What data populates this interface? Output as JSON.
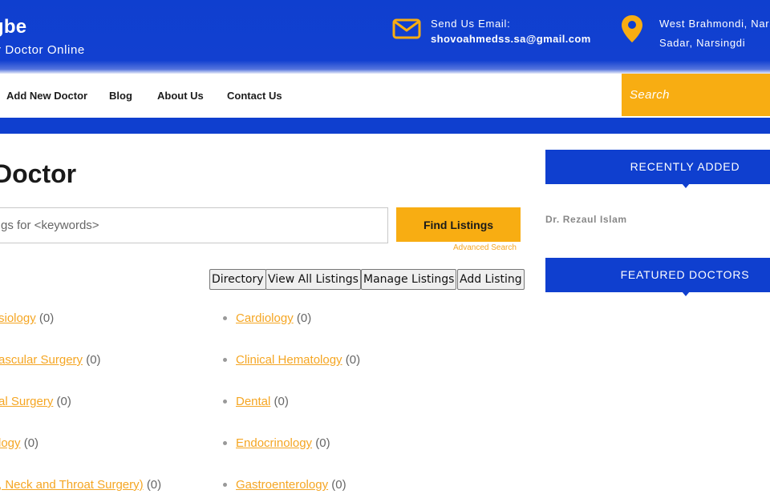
{
  "header": {
    "brand_title": "gbe",
    "brand_subtitle": "r Doctor Online",
    "email_label": "Send Us Email:",
    "email_value": "shovoahmedss.sa@gmail.com",
    "address_line1": "West Brahmondi, Nars",
    "address_line2": "Sadar, Narsingdi",
    "icons": {
      "email": "envelope-icon",
      "address": "map-pin-icon"
    },
    "colors": {
      "primary": "#0f3fcf",
      "accent": "#f8ad12"
    }
  },
  "nav": {
    "items": [
      "Add New Doctor",
      "Blog",
      "About Us",
      "Contact Us"
    ],
    "search_placeholder": "Search"
  },
  "main": {
    "title": "Doctor",
    "search_placeholder": "gs for <keywords>",
    "find_button": "Find Listings",
    "advanced_search": "Advanced Search",
    "action_buttons": [
      "Directory",
      "View All Listings",
      "Manage Listings",
      "Add Listing"
    ],
    "categories_left": [
      {
        "name": "siology",
        "count": "(0)"
      },
      {
        "name": "ascular Surgery",
        "count": "(0)"
      },
      {
        "name": "al Surgery",
        "count": "(0)"
      },
      {
        "name": "logy",
        "count": "(0)"
      },
      {
        "name": ", Neck and Throat Surgery)",
        "count": "(0)"
      }
    ],
    "categories_right": [
      {
        "name": "Cardiology",
        "count": "(0)"
      },
      {
        "name": "Clinical Hematology",
        "count": "(0)"
      },
      {
        "name": "Dental",
        "count": "(0)"
      },
      {
        "name": "Endocrinology",
        "count": "(0)"
      },
      {
        "name": "Gastroenterology",
        "count": "(0)"
      }
    ]
  },
  "sidebar": {
    "recently_added_title": "RECENTLY ADDED",
    "recent_items": [
      "Dr. Rezaul Islam"
    ],
    "featured_title": "FEATURED DOCTORS"
  }
}
